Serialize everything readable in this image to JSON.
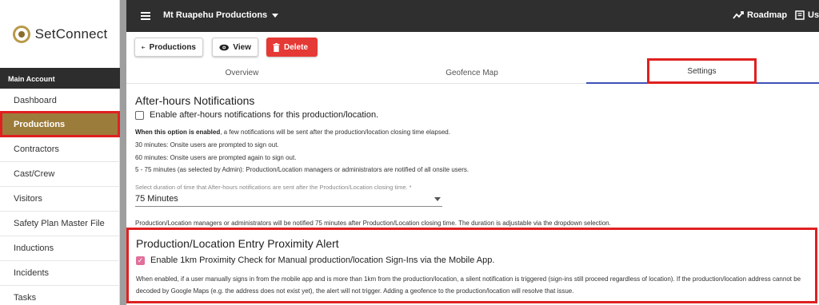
{
  "sidebar": {
    "logo_text": "SetConnect",
    "section_header": "Main Account",
    "items": [
      {
        "label": "Dashboard"
      },
      {
        "label": "Productions"
      },
      {
        "label": "Contractors"
      },
      {
        "label": "Cast/Crew"
      },
      {
        "label": "Visitors"
      },
      {
        "label": "Safety Plan Master File"
      },
      {
        "label": "Inductions"
      },
      {
        "label": "Incidents"
      },
      {
        "label": "Tasks"
      }
    ],
    "active_item": "Productions",
    "active_color": "#9c7c3b"
  },
  "topbar": {
    "production_name": "Mt Ruapehu Productions",
    "roadmap_label": "Roadmap",
    "user_label": "Use"
  },
  "actions": {
    "back_label": "Productions",
    "view_label": "View",
    "delete_label": "Delete"
  },
  "tabs": [
    {
      "label": "Overview"
    },
    {
      "label": "Geofence Map"
    },
    {
      "label": "Settings"
    }
  ],
  "active_tab": "Settings",
  "after_hours": {
    "title": "After-hours Notifications",
    "checkbox_label": "Enable after-hours notifications for this production/location.",
    "checked": false,
    "info_bold": "When this option is enabled",
    "info_rest": ", a few notifications will be sent after the production/location closing time elapsed.",
    "line1": "30 minutes: Onsite users are prompted to sign out.",
    "line2": "60 minutes: Onsite users are prompted again to sign out.",
    "line3": "5 - 75 minutes (as selected by Admin): Production/Location managers or administrators are notified of all onsite users.",
    "select_label": "Select duration of time that After-hours notifications are sent after the Production/Location closing time. *",
    "select_value": "75 Minutes",
    "summary": "Production/Location managers or administrators will be notified 75 minutes after Production/Location closing time. The duration is adjustable via the dropdown selection."
  },
  "proximity": {
    "title": "Production/Location Entry Proximity Alert",
    "checkbox_label": "Enable 1km Proximity Check for Manual production/location Sign-Ins via the Mobile App.",
    "checked": true,
    "description": "When enabled, if a user manually signs in from the mobile app and is more than 1km from the production/location, a silent notification is triggered (sign-ins still proceed regardless of location). If the production/location address cannot be decoded by Google Maps (e.g. the address does not exist yet), the alert will not trigger. Adding a geofence to the production/location will resolve that issue."
  },
  "colors": {
    "highlight": "#e02020",
    "accent": "#3f51b5",
    "delete": "#e53935",
    "checkbox": "#e0709a"
  }
}
